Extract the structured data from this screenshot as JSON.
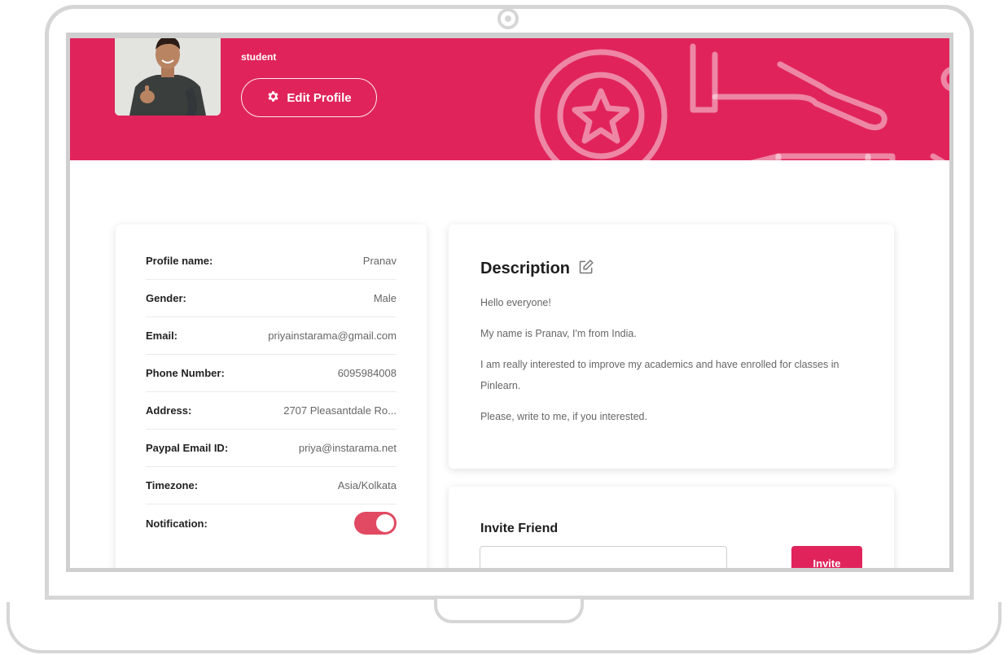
{
  "header": {
    "role": "student",
    "edit_profile_label": "Edit Profile"
  },
  "profile": {
    "rows": [
      {
        "label": "Profile name:",
        "value": "Pranav"
      },
      {
        "label": "Gender:",
        "value": "Male"
      },
      {
        "label": "Email:",
        "value": "priyainstarama@gmail.com"
      },
      {
        "label": "Phone Number:",
        "value": "6095984008"
      },
      {
        "label": "Address:",
        "value": "2707 Pleasantdale Ro..."
      },
      {
        "label": "Paypal Email ID:",
        "value": "priya@instarama.net"
      },
      {
        "label": "Timezone:",
        "value": "Asia/Kolkata"
      }
    ],
    "notification_label": "Notification:",
    "notification_on": true
  },
  "description": {
    "title": "Description",
    "paragraphs": [
      "Hello everyone!",
      "My name is Pranav, I'm from India.",
      "I am really interested to improve my academics and have enrolled for classes in Pinlearn.",
      "Please, write to me, if you interested."
    ]
  },
  "invite": {
    "title": "Invite Friend",
    "input_value": "",
    "button_label": "Invite"
  },
  "icons": {
    "settings": "gear-icon",
    "edit": "edit-icon"
  },
  "colors": {
    "brand": "#e0245b",
    "toggle": "#e14a62",
    "card_bg": "#ffffff",
    "frame": "#d6d6d6"
  }
}
